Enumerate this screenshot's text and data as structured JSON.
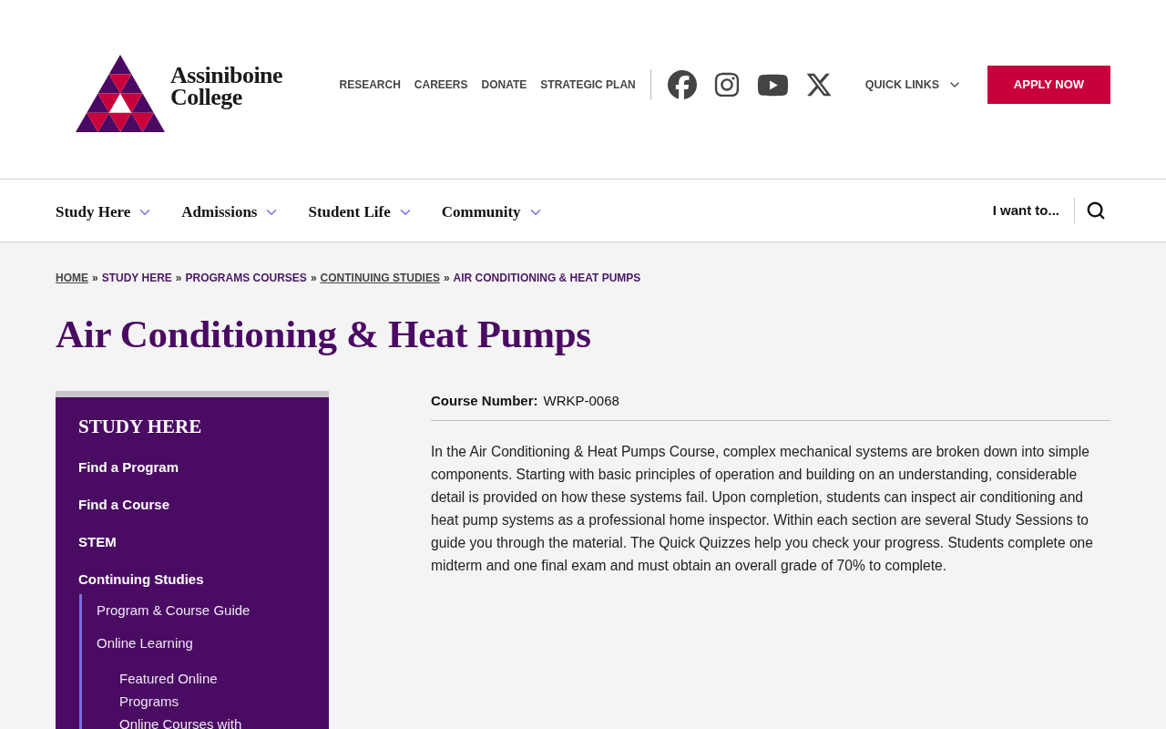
{
  "header": {
    "logo": {
      "lines": [
        "Assiniboine",
        "College"
      ]
    },
    "utility_links": [
      "RESEARCH",
      "CAREERS",
      "DONATE",
      "STRATEGIC PLAN"
    ],
    "quick_links": "QUICK LINKS",
    "apply_button": "APPLY NOW"
  },
  "main_nav": {
    "items": [
      "Study Here",
      "Admissions",
      "Student Life",
      "Community"
    ],
    "i_want_to": "I want to..."
  },
  "breadcrumb": [
    {
      "label": "HOME",
      "kind": "link"
    },
    {
      "separator": "»",
      "label": "STUDY HERE",
      "kind": "section"
    },
    {
      "separator": "»",
      "label": "PROGRAMS COURSES",
      "kind": "section"
    },
    {
      "separator": "»",
      "label": "CONTINUING STUDIES",
      "kind": "link"
    },
    {
      "separator": "»",
      "label": "AIR CONDITIONING & HEAT PUMPS",
      "kind": "section"
    }
  ],
  "page_title": "Air Conditioning & Heat Pumps",
  "sidebar": {
    "heading": "STUDY HERE",
    "items": [
      {
        "label": "Find a Program"
      },
      {
        "label": "Find a Course"
      },
      {
        "label": "STEM"
      },
      {
        "label": "Continuing Studies",
        "children": [
          {
            "label": "Program & Course Guide"
          },
          {
            "label": "Online Learning",
            "children": [
              {
                "label": "Featured Online Programs"
              },
              {
                "label": "Online Courses with"
              }
            ]
          }
        ]
      }
    ]
  },
  "course": {
    "label": "Course Number:",
    "value": "WRKP-0068",
    "description": "In the Air Conditioning & Heat Pumps Course, complex mechanical systems are broken down into simple components. Starting with basic principles of operation and building on an understanding, considerable detail is provided on how these systems fail. Upon completion, students can inspect air conditioning and heat pump systems as a professional home inspector. Within each section are several Study Sessions to guide you through the material. The Quick Quizzes help you check your progress. Students complete one midterm and one final exam and must obtain an overall grade of 70% to complete."
  }
}
